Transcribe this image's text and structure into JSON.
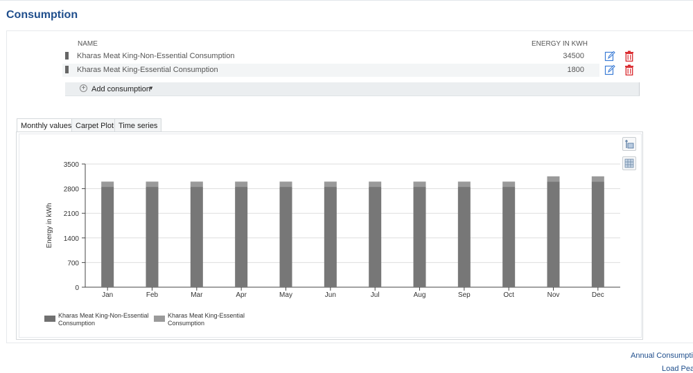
{
  "page": {
    "title": "Consumption"
  },
  "table": {
    "col_name": "NAME",
    "col_energy": "ENERGY IN KWH",
    "rows": [
      {
        "name": "Kharas Meat King-Non-Essential Consumption",
        "energy": "34500"
      },
      {
        "name": "Kharas Meat King-Essential Consumption",
        "energy": "1800"
      }
    ],
    "row_icons": [
      "edit-icon",
      "delete-icon"
    ],
    "add_label": "Add consumption"
  },
  "tabs": [
    {
      "label": "Monthly values",
      "active": true
    },
    {
      "label": "Carpet Plot",
      "active": false
    },
    {
      "label": "Time series",
      "active": false
    }
  ],
  "chart_data": {
    "type": "bar",
    "stacked": true,
    "categories": [
      "Jan",
      "Feb",
      "Mar",
      "Apr",
      "May",
      "Jun",
      "Jul",
      "Aug",
      "Sep",
      "Oct",
      "Nov",
      "Dec"
    ],
    "series": [
      {
        "name": "Kharas Meat King-Non-Essential Consumption",
        "color": "#777777",
        "values": [
          2850,
          2850,
          2850,
          2850,
          2850,
          2850,
          2850,
          2850,
          2850,
          2850,
          3000,
          3000
        ]
      },
      {
        "name": "Kharas Meat King-Essential Consumption",
        "color": "#999999",
        "values": [
          150,
          150,
          150,
          150,
          150,
          150,
          150,
          150,
          150,
          150,
          150,
          150
        ]
      }
    ],
    "ylabel": "Energy in kWh",
    "yticks": [
      0,
      700,
      1400,
      2100,
      2800,
      3500
    ],
    "ylim": [
      0,
      3500
    ],
    "grid": true,
    "legend_position": "bottom-left"
  },
  "legend": {
    "items": [
      {
        "line1": "Kharas Meat King-Non-Essential",
        "line2": "Consumption",
        "color": "#707070"
      },
      {
        "line1": "Kharas Meat King-Essential",
        "line2": "Consumption",
        "color": "#9a9a9a"
      }
    ]
  },
  "links": {
    "annual": "Annual Consumption",
    "load_peak": "Load Peak"
  },
  "colors": {
    "title": "#1f4e8c",
    "edit": "#3a7bd5",
    "delete": "#d9262b"
  }
}
